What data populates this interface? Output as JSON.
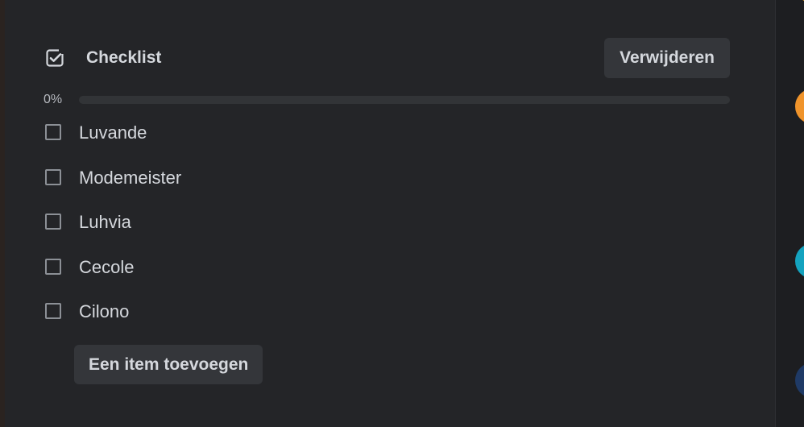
{
  "checklist": {
    "title": "Checklist",
    "delete_label": "Verwijderen",
    "progress_label": "0%",
    "progress_fraction": 0,
    "items": [
      {
        "label": "Luvande",
        "checked": false
      },
      {
        "label": "Modemeister",
        "checked": false
      },
      {
        "label": "Luhvia",
        "checked": false
      },
      {
        "label": "Cecole",
        "checked": false
      },
      {
        "label": "Cilono",
        "checked": false
      }
    ],
    "add_item_label": "Een item toevoegen"
  },
  "icons": {
    "header_icon": "checkbox-checked-icon"
  },
  "colors": {
    "panel_bg": "#242528",
    "button_bg": "#34363a",
    "text": "#d5d8dd",
    "avatar_orange": "#f0942b",
    "avatar_teal": "#14a3bf",
    "avatar_navy": "#1f3a66"
  }
}
